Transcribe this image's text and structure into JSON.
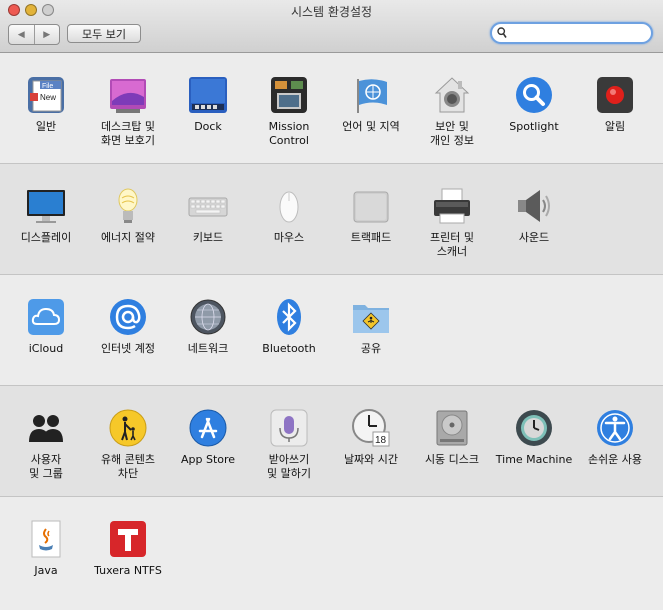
{
  "window": {
    "title": "시스템 환경설정",
    "show_all": "모두 보기",
    "search": {
      "value": "",
      "placeholder": ""
    },
    "nav": {
      "back": "◀",
      "forward": "▶"
    }
  },
  "rows": [
    {
      "items": [
        {
          "label": "일반",
          "icon": "general-icon"
        },
        {
          "label": "데스크탑 및\n화면 보호기",
          "icon": "desktop-screensaver-icon"
        },
        {
          "label": "Dock",
          "icon": "dock-icon"
        },
        {
          "label": "Mission\nControl",
          "icon": "mission-control-icon"
        },
        {
          "label": "언어 및 지역",
          "icon": "language-region-icon"
        },
        {
          "label": "보안 및\n개인 정보",
          "icon": "security-privacy-icon"
        },
        {
          "label": "Spotlight",
          "icon": "spotlight-icon"
        },
        {
          "label": "알림",
          "icon": "notifications-icon"
        }
      ]
    },
    {
      "items": [
        {
          "label": "디스플레이",
          "icon": "displays-icon"
        },
        {
          "label": "에너지 절약",
          "icon": "energy-saver-icon"
        },
        {
          "label": "키보드",
          "icon": "keyboard-icon"
        },
        {
          "label": "마우스",
          "icon": "mouse-icon"
        },
        {
          "label": "트랙패드",
          "icon": "trackpad-icon"
        },
        {
          "label": "프린터 및\n스캐너",
          "icon": "printer-scanner-icon"
        },
        {
          "label": "사운드",
          "icon": "sound-icon"
        }
      ]
    },
    {
      "items": [
        {
          "label": "iCloud",
          "icon": "icloud-icon"
        },
        {
          "label": "인터넷 계정",
          "icon": "internet-accounts-icon"
        },
        {
          "label": "네트워크",
          "icon": "network-icon"
        },
        {
          "label": "Bluetooth",
          "icon": "bluetooth-icon"
        },
        {
          "label": "공유",
          "icon": "sharing-icon"
        }
      ]
    },
    {
      "items": [
        {
          "label": "사용자\n및 그룹",
          "icon": "users-groups-icon"
        },
        {
          "label": "유해 콘텐츠\n차단",
          "icon": "parental-controls-icon"
        },
        {
          "label": "App Store",
          "icon": "app-store-icon"
        },
        {
          "label": "받아쓰기\n및 말하기",
          "icon": "dictation-speech-icon"
        },
        {
          "label": "날짜와 시간",
          "icon": "date-time-icon"
        },
        {
          "label": "시동 디스크",
          "icon": "startup-disk-icon"
        },
        {
          "label": "Time Machine",
          "icon": "time-machine-icon"
        },
        {
          "label": "손쉬운 사용",
          "icon": "accessibility-icon"
        }
      ]
    },
    {
      "items": [
        {
          "label": "Java",
          "icon": "java-icon"
        },
        {
          "label": "Tuxera NTFS",
          "icon": "tuxera-ntfs-icon"
        }
      ]
    }
  ],
  "icon_texts": {
    "general_file": "File",
    "general_new": "New",
    "date_day": "18"
  }
}
